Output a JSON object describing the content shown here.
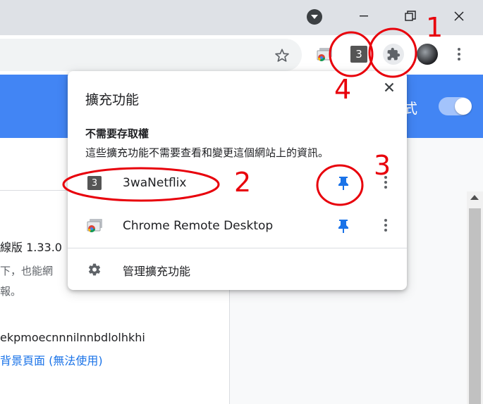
{
  "popup": {
    "title": "擴充功能",
    "section_title": "不需要存取權",
    "section_desc": "這些擴充功能不需要查看和變更這個網站上的資訊。",
    "extensions": [
      {
        "name": "3waNetflix",
        "icon_label": "3",
        "icon": "netflix-3-icon",
        "pinned": true
      },
      {
        "name": "Chrome Remote Desktop",
        "icon": "chrome-remote-desktop-icon",
        "pinned": true
      }
    ],
    "manage_label": "管理擴充功能"
  },
  "toolbar": {
    "ext_badge_label": "3"
  },
  "page": {
    "header_partial": "式",
    "version_line": "線版  1.33.0",
    "line2": "下，也能網",
    "line3": "報。",
    "ext_id": "ekpmoecnnnilnnbdlolhkhi",
    "bg_page": "背景頁面 (無法使用)"
  },
  "annotations": [
    "1",
    "2",
    "3",
    "4"
  ],
  "colors": {
    "accent_blue": "#4285f4",
    "pin_blue": "#1a73e8",
    "annotation_red": "#e8000b"
  }
}
